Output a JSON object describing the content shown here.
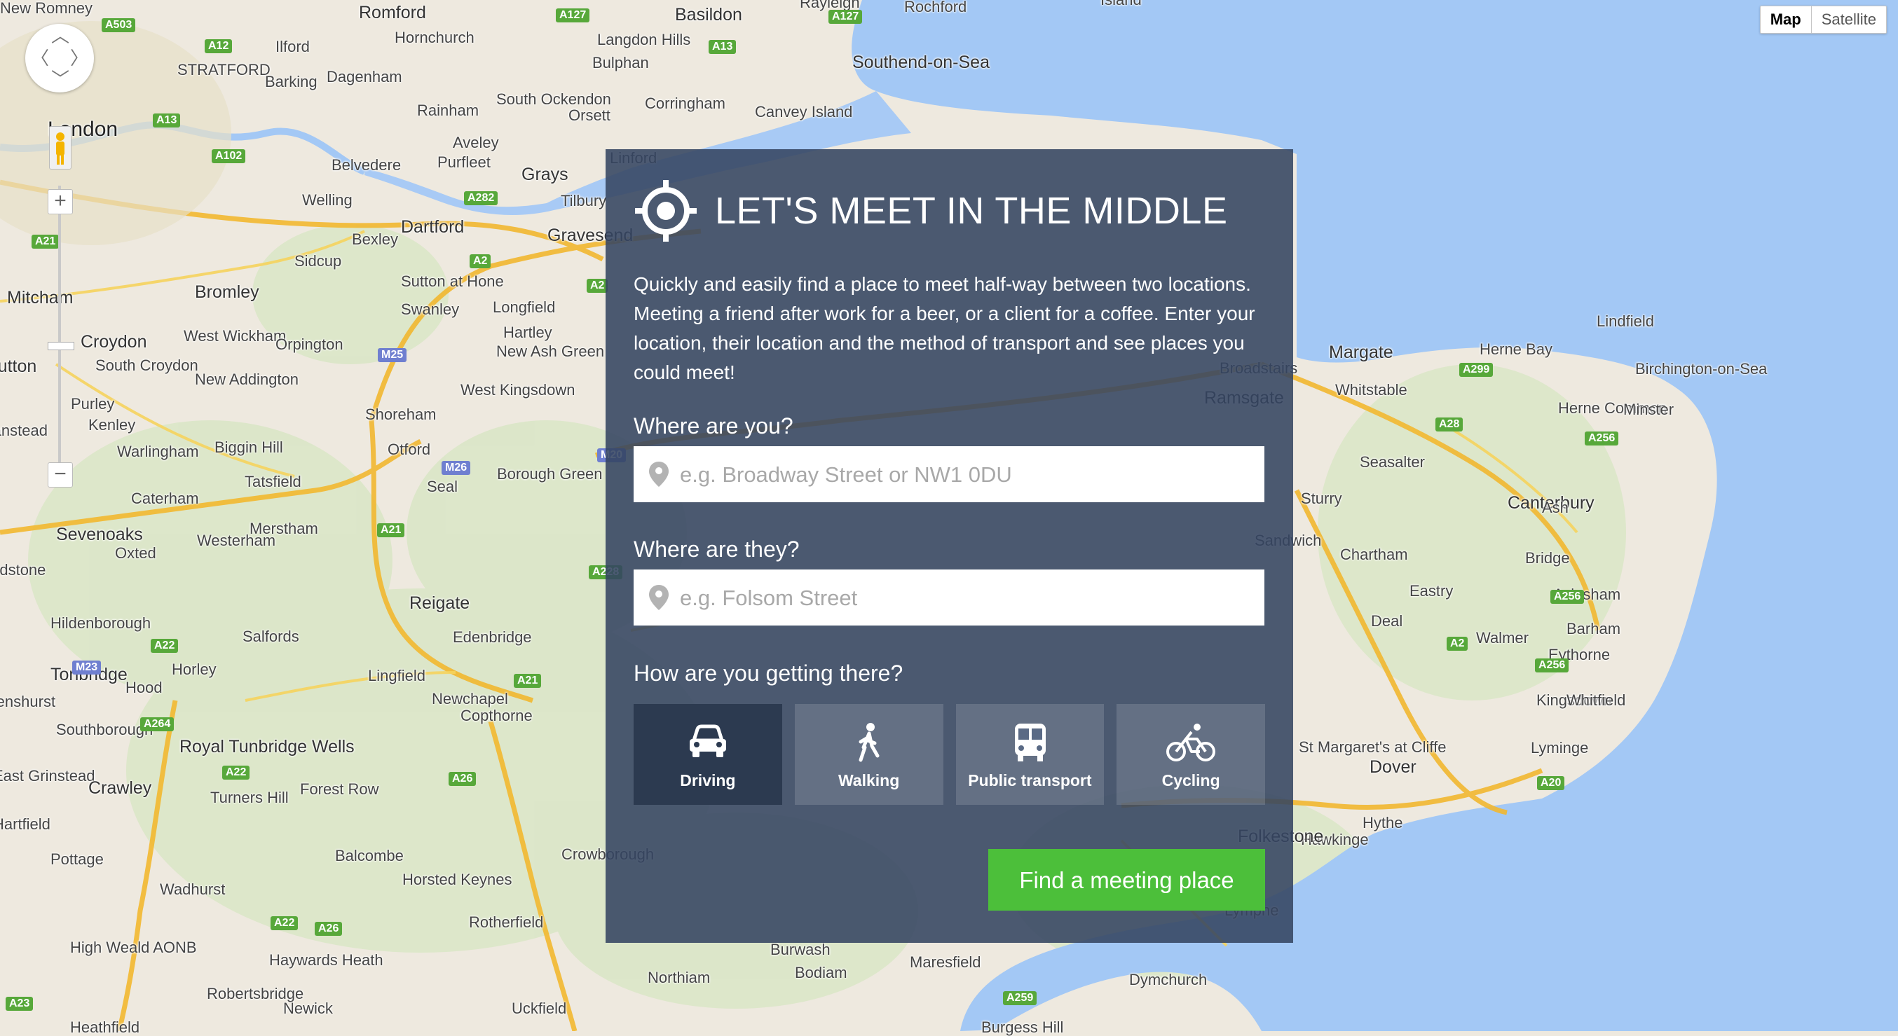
{
  "map": {
    "type_control": {
      "map_label": "Map",
      "satellite_label": "Satellite"
    },
    "zoom": {
      "in_label": "+",
      "out_label": "−"
    },
    "places": [
      {
        "name": "Romford",
        "cls": "mid"
      },
      {
        "name": "Basildon",
        "cls": "mid"
      },
      {
        "name": "Rayleigh",
        "cls": "small"
      },
      {
        "name": "Rochford",
        "cls": "small"
      },
      {
        "name": "Island",
        "cls": "small"
      },
      {
        "name": "Ilford",
        "cls": "small"
      },
      {
        "name": "Hornchurch",
        "cls": "small"
      },
      {
        "name": "Langdon Hills",
        "cls": "small"
      },
      {
        "name": "Southend-on-Sea",
        "cls": "mid"
      },
      {
        "name": "Bulphan",
        "cls": "small"
      },
      {
        "name": "STRATFORD",
        "cls": "small"
      },
      {
        "name": "Barking",
        "cls": "small"
      },
      {
        "name": "Dagenham",
        "cls": "small"
      },
      {
        "name": "London",
        "cls": "major"
      },
      {
        "name": "South Ockendon",
        "cls": "small"
      },
      {
        "name": "Orsett",
        "cls": "small"
      },
      {
        "name": "Corringham",
        "cls": "small"
      },
      {
        "name": "Canvey Island",
        "cls": "small"
      },
      {
        "name": "Rainham",
        "cls": "small"
      },
      {
        "name": "Aveley",
        "cls": "small"
      },
      {
        "name": "Purfleet",
        "cls": "small"
      },
      {
        "name": "Grays",
        "cls": "mid"
      },
      {
        "name": "Linford",
        "cls": "small"
      },
      {
        "name": "Belvedere",
        "cls": "small"
      },
      {
        "name": "Welling",
        "cls": "small"
      },
      {
        "name": "Tilbury",
        "cls": "small"
      },
      {
        "name": "Dartford",
        "cls": "mid"
      },
      {
        "name": "Gravesend",
        "cls": "mid"
      },
      {
        "name": "Bexley",
        "cls": "small"
      },
      {
        "name": "Sidcup",
        "cls": "small"
      },
      {
        "name": "Mitcham",
        "cls": "mid"
      },
      {
        "name": "Bromley",
        "cls": "mid"
      },
      {
        "name": "Sutton at Hone",
        "cls": "small"
      },
      {
        "name": "Swanley",
        "cls": "small"
      },
      {
        "name": "Longfield",
        "cls": "small"
      },
      {
        "name": "Hartley",
        "cls": "small"
      },
      {
        "name": "New Ash Green",
        "cls": "small"
      },
      {
        "name": "Croydon",
        "cls": "mid"
      },
      {
        "name": "West Wickham",
        "cls": "small"
      },
      {
        "name": "Orpington",
        "cls": "small"
      },
      {
        "name": "Sutton",
        "cls": "mid"
      },
      {
        "name": "South Croydon",
        "cls": "small"
      },
      {
        "name": "New Addington",
        "cls": "small"
      },
      {
        "name": "Purley",
        "cls": "small"
      },
      {
        "name": "Kenley",
        "cls": "small"
      },
      {
        "name": "West Kingsdown",
        "cls": "small"
      },
      {
        "name": "Shoreham",
        "cls": "small"
      },
      {
        "name": "Banstead",
        "cls": "small"
      },
      {
        "name": "Warlingham",
        "cls": "small"
      },
      {
        "name": "Biggin Hill",
        "cls": "small"
      },
      {
        "name": "Otford",
        "cls": "small"
      },
      {
        "name": "Borough Green",
        "cls": "small"
      },
      {
        "name": "Seal",
        "cls": "small"
      },
      {
        "name": "Caterham",
        "cls": "small"
      },
      {
        "name": "Tatsfield",
        "cls": "small"
      },
      {
        "name": "Sevenoaks",
        "cls": "mid"
      },
      {
        "name": "Merstham",
        "cls": "small"
      },
      {
        "name": "Westerham",
        "cls": "small"
      },
      {
        "name": "Oxted",
        "cls": "small"
      },
      {
        "name": "Godstone",
        "cls": "small"
      },
      {
        "name": "Reigate",
        "cls": "mid"
      },
      {
        "name": "Hildenborough",
        "cls": "small"
      },
      {
        "name": "Salfords",
        "cls": "small"
      },
      {
        "name": "Edenbridge",
        "cls": "small"
      },
      {
        "name": "Tonbridge",
        "cls": "mid"
      },
      {
        "name": "Horley",
        "cls": "small"
      },
      {
        "name": "Lingfield",
        "cls": "small"
      },
      {
        "name": "Penshurst",
        "cls": "small"
      },
      {
        "name": "Hood",
        "cls": "small"
      },
      {
        "name": "Newchapel",
        "cls": "small"
      },
      {
        "name": "Southborough",
        "cls": "small"
      },
      {
        "name": "Copthorne",
        "cls": "small"
      },
      {
        "name": "Royal Tunbridge Wells",
        "cls": "mid"
      },
      {
        "name": "East Grinstead",
        "cls": "small"
      },
      {
        "name": "Crawley",
        "cls": "mid"
      },
      {
        "name": "Turners Hill",
        "cls": "small"
      },
      {
        "name": "Forest Row",
        "cls": "small"
      },
      {
        "name": "Hartfield",
        "cls": "small"
      },
      {
        "name": "Pottage",
        "cls": "small"
      },
      {
        "name": "Balcombe",
        "cls": "small"
      },
      {
        "name": "Crowborough",
        "cls": "small"
      },
      {
        "name": "Wadhurst",
        "cls": "small"
      },
      {
        "name": "Horsted Keynes",
        "cls": "small"
      },
      {
        "name": "Rotherfield",
        "cls": "small"
      },
      {
        "name": "High Weald AONB",
        "cls": "small"
      },
      {
        "name": "Haywards Heath",
        "cls": "small"
      },
      {
        "name": "Maresfield",
        "cls": "small"
      },
      {
        "name": "Burwash",
        "cls": "small"
      },
      {
        "name": "Bodiam",
        "cls": "small"
      },
      {
        "name": "Northiam",
        "cls": "small"
      },
      {
        "name": "Robertsbridge",
        "cls": "small"
      },
      {
        "name": "Newick",
        "cls": "small"
      },
      {
        "name": "Uckfield",
        "cls": "small"
      },
      {
        "name": "Heathfield",
        "cls": "small"
      },
      {
        "name": "Burgess Hill",
        "cls": "small"
      },
      {
        "name": "Lindfield",
        "cls": "small"
      },
      {
        "name": "Margate",
        "cls": "mid"
      },
      {
        "name": "Herne Bay",
        "cls": "small"
      },
      {
        "name": "Birchington-on-Sea",
        "cls": "small"
      },
      {
        "name": "Broadstairs",
        "cls": "small"
      },
      {
        "name": "Whitstable",
        "cls": "small"
      },
      {
        "name": "Herne Common",
        "cls": "small"
      },
      {
        "name": "Minster",
        "cls": "small"
      },
      {
        "name": "Ramsgate",
        "cls": "mid"
      },
      {
        "name": "Seasalter",
        "cls": "small"
      },
      {
        "name": "Sturry",
        "cls": "small"
      },
      {
        "name": "Canterbury",
        "cls": "mid"
      },
      {
        "name": "Ash",
        "cls": "small"
      },
      {
        "name": "Sandwich",
        "cls": "small"
      },
      {
        "name": "Chartham",
        "cls": "small"
      },
      {
        "name": "Bridge",
        "cls": "small"
      },
      {
        "name": "Eastry",
        "cls": "small"
      },
      {
        "name": "Aylesham",
        "cls": "small"
      },
      {
        "name": "Deal",
        "cls": "small"
      },
      {
        "name": "Barham",
        "cls": "small"
      },
      {
        "name": "Walmer",
        "cls": "small"
      },
      {
        "name": "Eythorne",
        "cls": "small"
      },
      {
        "name": "Kingsdown",
        "cls": "small"
      },
      {
        "name": "Whitfield",
        "cls": "small"
      },
      {
        "name": "St Margaret's at Cliffe",
        "cls": "small"
      },
      {
        "name": "Lyminge",
        "cls": "small"
      },
      {
        "name": "Dover",
        "cls": "mid"
      },
      {
        "name": "Hawkinge",
        "cls": "small"
      },
      {
        "name": "Hythe",
        "cls": "small"
      },
      {
        "name": "Folkestone",
        "cls": "mid"
      },
      {
        "name": "Lympne",
        "cls": "small"
      },
      {
        "name": "Dymchurch",
        "cls": "small"
      },
      {
        "name": "New Romney",
        "cls": "small"
      }
    ],
    "roads": [
      {
        "label": "A503",
        "cls": "g"
      },
      {
        "label": "A12",
        "cls": "g"
      },
      {
        "label": "A127",
        "cls": "g"
      },
      {
        "label": "A127",
        "cls": "g"
      },
      {
        "label": "A13",
        "cls": "g"
      },
      {
        "label": "A13",
        "cls": "g"
      },
      {
        "label": "A102",
        "cls": "g"
      },
      {
        "label": "A282",
        "cls": "g"
      },
      {
        "label": "A2",
        "cls": "g"
      },
      {
        "label": "A2",
        "cls": "g"
      },
      {
        "label": "A21",
        "cls": "g"
      },
      {
        "label": "M25",
        "cls": "b"
      },
      {
        "label": "M26",
        "cls": "b"
      },
      {
        "label": "M20",
        "cls": "b"
      },
      {
        "label": "A21",
        "cls": "g"
      },
      {
        "label": "A228",
        "cls": "g"
      },
      {
        "label": "A22",
        "cls": "g"
      },
      {
        "label": "M23",
        "cls": "b"
      },
      {
        "label": "A264",
        "cls": "g"
      },
      {
        "label": "A21",
        "cls": "g"
      },
      {
        "label": "A22",
        "cls": "g"
      },
      {
        "label": "A26",
        "cls": "g"
      },
      {
        "label": "A22",
        "cls": "g"
      },
      {
        "label": "A26",
        "cls": "g"
      },
      {
        "label": "A23",
        "cls": "g"
      },
      {
        "label": "A259",
        "cls": "g"
      },
      {
        "label": "A299",
        "cls": "g"
      },
      {
        "label": "A28",
        "cls": "g"
      },
      {
        "label": "A256",
        "cls": "g"
      },
      {
        "label": "A256",
        "cls": "g"
      },
      {
        "label": "A2",
        "cls": "g"
      },
      {
        "label": "A256",
        "cls": "g"
      },
      {
        "label": "A20",
        "cls": "g"
      }
    ]
  },
  "panel": {
    "title": "LET'S MEET IN THE MIDDLE",
    "intro": "Quickly and easily find a place to meet half-way between two locations. Meeting a friend after work for a beer, or a client for a coffee. Enter your location, their location and the method of transport and see places you could meet!",
    "you": {
      "label": "Where are you?",
      "placeholder": "e.g. Broadway Street or NW1 0DU",
      "value": ""
    },
    "they": {
      "label": "Where are they?",
      "placeholder": "e.g. Folsom Street",
      "value": ""
    },
    "transport": {
      "label": "How are you getting there?",
      "modes": [
        {
          "label": "Driving",
          "icon": "car-icon",
          "selected": true
        },
        {
          "label": "Walking",
          "icon": "walking-icon",
          "selected": false
        },
        {
          "label": "Public transport",
          "icon": "bus-icon",
          "selected": false
        },
        {
          "label": "Cycling",
          "icon": "bicycle-icon",
          "selected": false
        }
      ]
    },
    "submit_label": "Find a meeting place"
  },
  "colors": {
    "panel_bg": "#344461",
    "accent_green": "#4cbf3a",
    "selected_mode": "#2c3a50",
    "sea": "#a3c8f5",
    "land": "#eee9df"
  }
}
